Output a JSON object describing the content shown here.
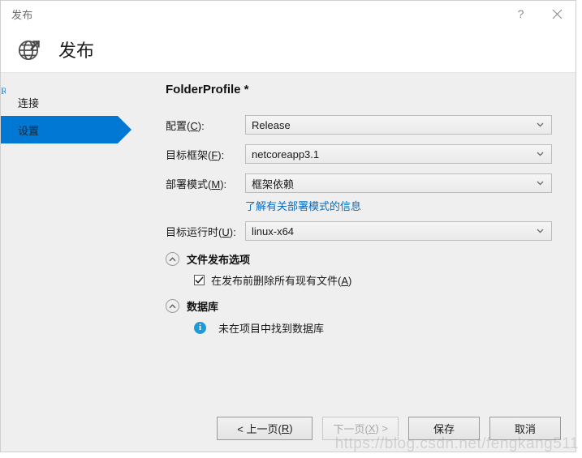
{
  "window": {
    "title": "发布",
    "help_label": "?",
    "close_label": "✕"
  },
  "header": {
    "icon": "globe-publish-icon",
    "title": "发布"
  },
  "sidebar": {
    "items": [
      {
        "label": "连接",
        "selected": false
      },
      {
        "label": "设置",
        "selected": true
      }
    ]
  },
  "main": {
    "profile_title": "FolderProfile *",
    "fields": [
      {
        "label_prefix": "配置(",
        "label_key": "C",
        "label_suffix": "):",
        "value": "Release",
        "icon": "chevron-down-icon"
      },
      {
        "label_prefix": "目标框架(",
        "label_key": "F",
        "label_suffix": "):",
        "value": "netcoreapp3.1",
        "icon": "chevron-down-icon"
      },
      {
        "label_prefix": "部署模式(",
        "label_key": "M",
        "label_suffix": "):",
        "value": "框架依赖",
        "icon": "chevron-down-icon"
      },
      {
        "label_prefix": "目标运行时(",
        "label_key": "U",
        "label_suffix": "):",
        "value": "linux-x64",
        "icon": "chevron-down-icon"
      }
    ],
    "deployment_link": "了解有关部署模式的信息",
    "sections": [
      {
        "title": "文件发布选项",
        "expander_icon": "chevron-up-circle-icon",
        "checkbox": {
          "checked": true,
          "check_glyph": "✓",
          "label_prefix": "在发布前删除所有现有文件(",
          "label_key": "A",
          "label_suffix": ")"
        }
      },
      {
        "title": "数据库",
        "expander_icon": "chevron-up-circle-icon",
        "info": {
          "icon": "info-circle-icon",
          "glyph": "i",
          "text": "未在项目中找到数据库"
        }
      }
    ]
  },
  "footer": {
    "prev": {
      "prefix": "< 上一页(",
      "key": "R",
      "suffix": ")",
      "disabled": false
    },
    "next": {
      "prefix": "下一页(",
      "key": "X",
      "suffix": ") >",
      "disabled": true
    },
    "save": {
      "label": "保存",
      "disabled": false
    },
    "cancel": {
      "label": "取消",
      "disabled": false
    }
  },
  "watermark": "https://blog.csdn.net/fengkang511",
  "colors": {
    "accent": "#0078d4",
    "link": "#0a6cbf",
    "info": "#1d9bd9",
    "dialog_bg": "#efeff0"
  }
}
